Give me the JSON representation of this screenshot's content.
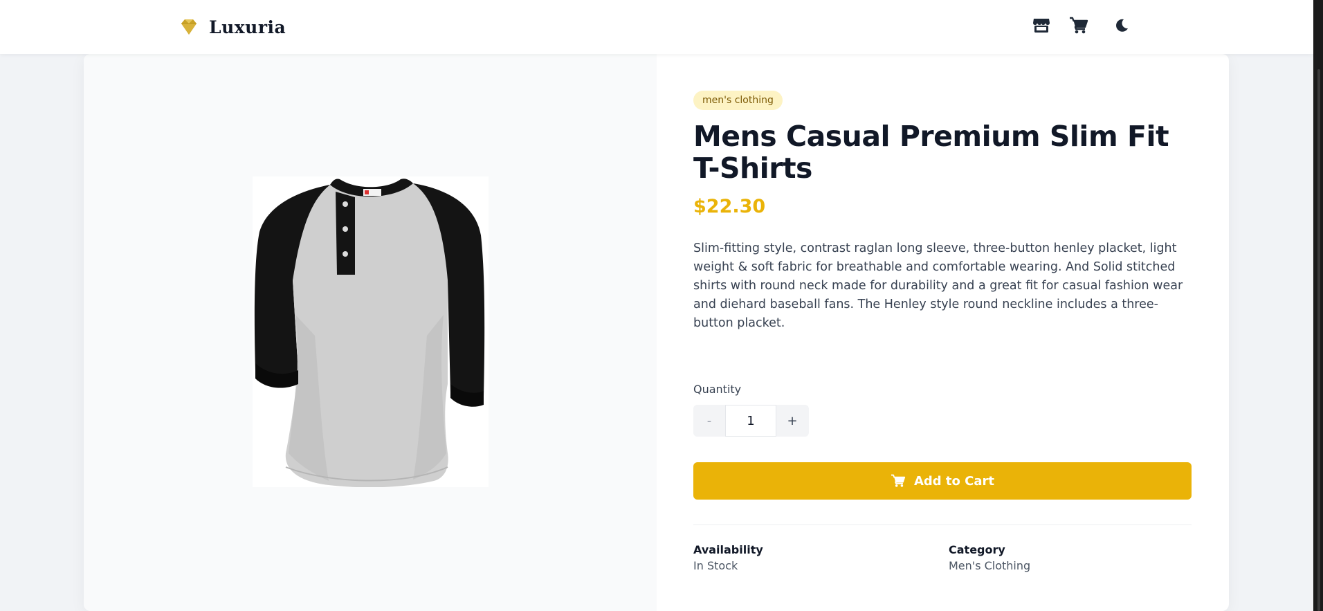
{
  "header": {
    "brand_name": "Luxuria",
    "brand_color": "#c9a227",
    "icons": [
      "store-icon",
      "cart-icon",
      "moon-icon"
    ]
  },
  "product": {
    "category_badge": "men's clothing",
    "title": "Mens Casual Premium Slim Fit T-Shirts",
    "price": "$22.30",
    "description": "Slim-fitting style, contrast raglan long sleeve, three-button henley placket, light weight & soft fabric for breathable and comfortable wearing. And Solid stitched shirts with round neck made for durability and a great fit for casual fashion wear and diehard baseball fans. The Henley style round neckline includes a three-button placket.",
    "image_icon": "henley-shirt-image"
  },
  "purchase": {
    "quantity_label": "Quantity",
    "quantity_value": "1",
    "minus_label": "-",
    "plus_label": "+",
    "add_to_cart_label": "Add to Cart"
  },
  "details": {
    "availability_label": "Availability",
    "availability_value": "In Stock",
    "category_label": "Category",
    "category_value": "Men's Clothing"
  },
  "colors": {
    "accent": "#eab308",
    "badge_bg": "#fdf3c4",
    "badge_text": "#7c5a05",
    "title": "#111827"
  }
}
